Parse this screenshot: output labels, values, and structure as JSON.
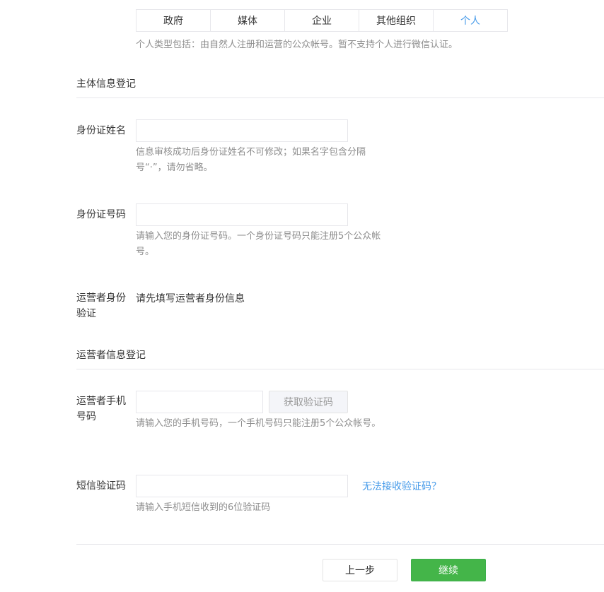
{
  "tabs": [
    {
      "label": "政府",
      "active": false
    },
    {
      "label": "媒体",
      "active": false
    },
    {
      "label": "企业",
      "active": false
    },
    {
      "label": "其他组织",
      "active": false
    },
    {
      "label": "个人",
      "active": true
    }
  ],
  "type_description": "个人类型包括：由自然人注册和运营的公众帐号。暂不支持个人进行微信认证。",
  "section_subject": {
    "title": "主体信息登记"
  },
  "id_name": {
    "label": "身份证姓名",
    "value": "",
    "hint": "信息审核成功后身份证姓名不可修改；如果名字包含分隔号“·”，请勿省略。"
  },
  "id_number": {
    "label": "身份证号码",
    "value": "",
    "hint": "请输入您的身份证号码。一个身份证号码只能注册5个公众帐号。"
  },
  "operator_verify": {
    "label": "运营者身份验证",
    "value": "请先填写运营者身份信息"
  },
  "section_operator": {
    "title": "运营者信息登记"
  },
  "phone": {
    "label": "运营者手机号码",
    "value": "",
    "get_code_label": "获取验证码",
    "hint": "请输入您的手机号码，一个手机号码只能注册5个公众帐号。"
  },
  "sms_code": {
    "label": "短信验证码",
    "value": "",
    "cannot_receive_link": "无法接收验证码？",
    "hint": "请输入手机短信收到的6位验证码"
  },
  "footer": {
    "prev_label": "上一步",
    "next_label": "继续"
  },
  "colors": {
    "accent": "#459ae9",
    "primary_button": "#44b549",
    "hint_text": "#8d8d8d"
  }
}
